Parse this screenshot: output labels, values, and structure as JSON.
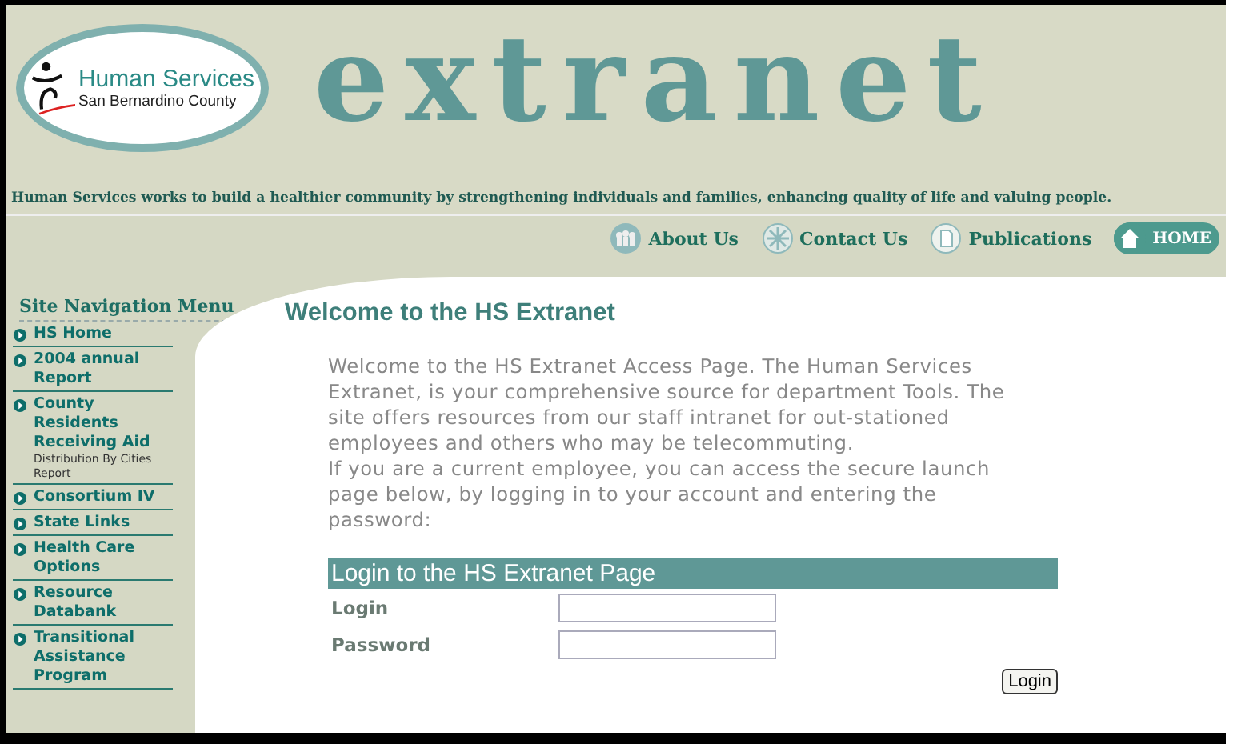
{
  "logo": {
    "title": "Human Services",
    "subtitle": "San Bernardino County"
  },
  "banner_title": "extranet",
  "tagline": "Human Services  works to build a healthier community by strengthening individuals and families, enhancing quality of life and valuing people.",
  "top_nav": [
    {
      "label": "About Us",
      "kind": "people"
    },
    {
      "label": "Contact Us",
      "kind": "star"
    },
    {
      "label": "Publications",
      "kind": "page"
    },
    {
      "label": "HOME",
      "kind": "home"
    }
  ],
  "sidebar": {
    "title": "Site Navigation Menu",
    "items": [
      {
        "label": "HS Home"
      },
      {
        "label": "2004 annual Report"
      },
      {
        "label": "County Residents Receiving Aid",
        "sublabel": "Distribution By Cities Report"
      },
      {
        "label": "Consortium IV"
      },
      {
        "label": "State Links"
      },
      {
        "label": "Health Care Options"
      },
      {
        "label": "Resource Databank"
      },
      {
        "label": "Transitional Assistance Program"
      }
    ]
  },
  "heading": "Welcome to the HS Extranet",
  "paragraphs": [
    "Welcome to the HS Extranet Access Page. The Human Services Extranet, is your comprehensive source for department Tools. The site offers resources from our staff intranet for out-stationed employees and others who may be telecommuting.",
    "If you are a current employee, you can access the secure launch page below, by logging in to your account and entering the password:"
  ],
  "login": {
    "title": "Login to the HS Extranet Page",
    "fields": [
      {
        "label": "Login"
      },
      {
        "label": "Password"
      }
    ],
    "button": "Login"
  }
}
